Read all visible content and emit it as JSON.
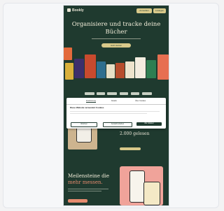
{
  "app": {
    "logo_text": "Bookly",
    "header_buttons": [
      "Anmelden",
      "Loslegen"
    ]
  },
  "hero": {
    "title": "Organisiere und tracke deine Bücher",
    "cta_label": "Jetzt starten"
  },
  "cookie_banner": {
    "tabs": [
      "Zustimmung",
      "Details",
      "Über Cookies"
    ],
    "title": "Diese Website verwendet Cookies",
    "buttons": [
      "Ablehnen",
      "Auswahl erlauben",
      "Alle zulassen"
    ]
  },
  "stats": {
    "headline": "2.000 gelesen"
  },
  "section3": {
    "title_line1": "Meilensteine die",
    "title_accent": "mehr messen."
  },
  "colors": {
    "page_bg": "#1f3a2f",
    "accent_gold": "#d8c98a",
    "accent_coral": "#e58a6e",
    "cream_text": "#f1ecd8"
  }
}
